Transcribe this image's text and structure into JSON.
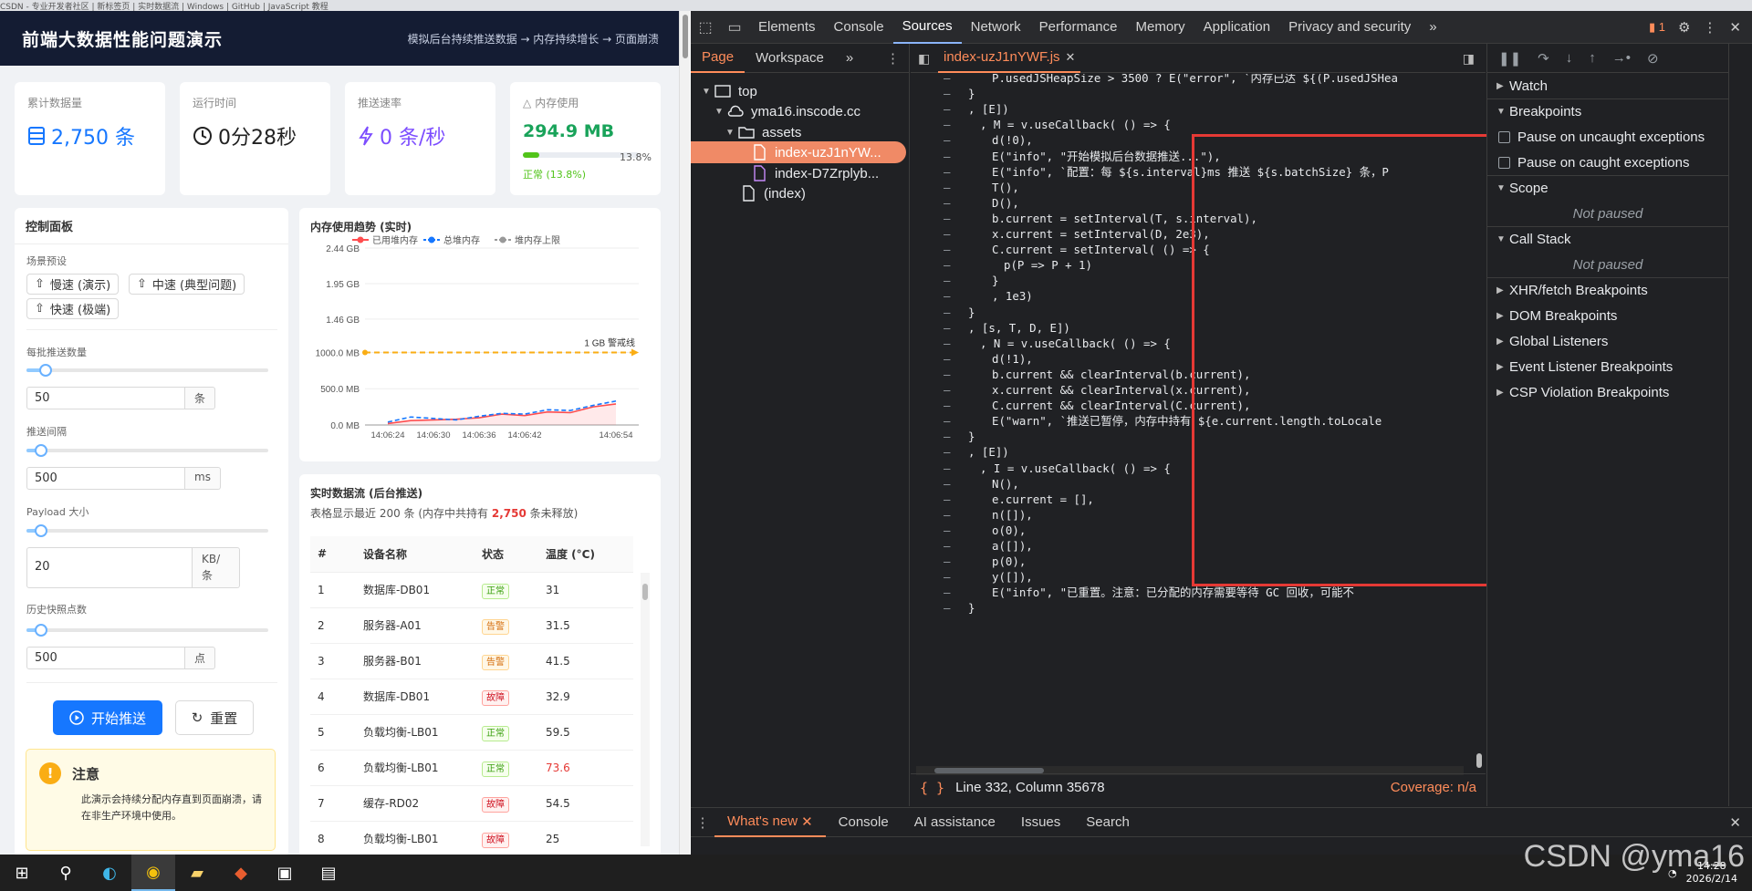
{
  "app": {
    "title": "前端大数据性能问题演示",
    "subtitle": "模拟后台持续推送数据 → 内存持续增长 → 页面崩溃",
    "stats": {
      "total_label": "累计数据量",
      "total_value": "2,750 条",
      "runtime_label": "运行时间",
      "runtime_value": "0分28秒",
      "rate_label": "推送速率",
      "rate_value": "0 条/秒",
      "memory_label": "内存使用",
      "memory_value": "294.9 MB",
      "memory_pct": "13.8%",
      "memory_fraction": 0.138,
      "memory_status": "正常 (13.8%)"
    },
    "control": {
      "title": "控制面板",
      "preset_label": "场景预设",
      "presets": [
        "慢速 (演示)",
        "中速 (典型问题)",
        "快速 (极端)"
      ],
      "batch_label": "每批推送数量",
      "batch_value": "50",
      "batch_unit": "条",
      "batch_fraction": 0.08,
      "interval_label": "推送间隔",
      "interval_value": "500",
      "interval_unit": "ms",
      "interval_fraction": 0.06,
      "payload_label": "Payload 大小",
      "payload_value": "20",
      "payload_unit": "KB/条",
      "payload_fraction": 0.06,
      "snapshot_label": "历史快照点数",
      "snapshot_value": "500",
      "snapshot_unit": "点",
      "snapshot_fraction": 0.06,
      "start_label": "开始推送",
      "reset_label": "重置",
      "notice_title": "注意",
      "notice_text": "此演示会持续分配内存直到页面崩溃，请在非生产环境中使用。"
    },
    "chart_title": "内存使用趋势 (实时)",
    "table": {
      "title": "实时数据流 (后台推送)",
      "sub_prefix": "表格显示最近 200 条 (内存中共持有",
      "sub_count": "2,750",
      "sub_suffix": "条未释放)",
      "headers": [
        "#",
        "设备名称",
        "状态",
        "温度 (°C)"
      ],
      "rows": [
        {
          "n": "1",
          "name": "数据库-DB01",
          "status": "正常",
          "level": "ok",
          "temp": "31"
        },
        {
          "n": "2",
          "name": "服务器-A01",
          "status": "告警",
          "level": "warn",
          "temp": "31.5"
        },
        {
          "n": "3",
          "name": "服务器-B01",
          "status": "告警",
          "level": "warn",
          "temp": "41.5"
        },
        {
          "n": "4",
          "name": "数据库-DB01",
          "status": "故障",
          "level": "err",
          "temp": "32.9"
        },
        {
          "n": "5",
          "name": "负载均衡-LB01",
          "status": "正常",
          "level": "ok",
          "temp": "59.5"
        },
        {
          "n": "6",
          "name": "负载均衡-LB01",
          "status": "正常",
          "level": "ok",
          "temp": "73.6",
          "hot": true
        },
        {
          "n": "7",
          "name": "缓存-RD02",
          "status": "故障",
          "level": "err",
          "temp": "54.5"
        },
        {
          "n": "8",
          "name": "负载均衡-LB01",
          "status": "故障",
          "level": "err",
          "temp": "25"
        }
      ]
    }
  },
  "chart_data": {
    "type": "line",
    "title": "内存使用趋势 (实时)",
    "legend": [
      "已用堆内存",
      "总堆内存",
      "堆内存上限"
    ],
    "legend_position": "top",
    "y_ticks": [
      "2.44 GB",
      "1.95 GB",
      "1.46 GB",
      "1000.0 MB",
      "500.0 MB",
      "0.0 MB"
    ],
    "y_tick_values": [
      2440,
      1950,
      1460,
      1000,
      500,
      0
    ],
    "ylim": [
      0,
      2440
    ],
    "x_ticks": [
      "14:06:24",
      "14:06:30",
      "14:06:36",
      "14:06:42",
      "14:06:54"
    ],
    "x_tick_values": [
      0,
      6,
      12,
      18,
      30
    ],
    "xlim": [
      -3,
      33
    ],
    "threshold": {
      "label": "1 GB 警戒线",
      "value": 1000
    },
    "series": [
      {
        "name": "已用堆内存",
        "color": "#ff4d4f",
        "x": [
          0,
          3,
          6,
          9,
          12,
          15,
          18,
          21,
          24,
          27,
          30
        ],
        "values": [
          20,
          60,
          70,
          80,
          100,
          150,
          130,
          180,
          170,
          250,
          290
        ]
      },
      {
        "name": "总堆内存",
        "color": "#1677ff",
        "x": [
          0,
          3,
          6,
          9,
          12,
          15,
          18,
          21,
          24,
          27,
          30
        ],
        "values": [
          40,
          110,
          90,
          70,
          120,
          160,
          150,
          210,
          200,
          270,
          330
        ]
      }
    ],
    "grid": true
  },
  "browser_tabs": "CSDN - 专业开发者社区 | 新标签页 | 实时数据流 | Windows | GitHub | JavaScript 教程",
  "devtools": {
    "tabs": [
      "Elements",
      "Console",
      "Sources",
      "Network",
      "Performance",
      "Memory",
      "Application",
      "Privacy and security"
    ],
    "active_tab": "Sources",
    "issues_count": "1",
    "nav_tabs": [
      "Page",
      "Workspace"
    ],
    "tree": [
      "top",
      "yma16.inscode.cc",
      "assets",
      "index-uzJ1nYW...",
      "index-D7Zrplyb...",
      "(index)"
    ],
    "file_tab": "index-uzJ1nYWF.js",
    "code_lines": [
      "P.usedJSHeapSize > 3500 ? E(\"error\", `内存已达 ${(P.usedJSHea",
      "}",
      ", [E])",
      ", M = v.useCallback( () => {",
      "d(!0),",
      "E(\"info\", \"开始模拟后台数据推送...\"),",
      "E(\"info\", `配置：每 ${s.interval}ms 推送 ${s.batchSize} 条，P",
      "T(),",
      "D(),",
      "b.current = setInterval(T, s.interval),",
      "x.current = setInterval(D, 2e3),",
      "C.current = setInterval( () => {",
      "p(P => P + 1)",
      "}",
      ", 1e3)",
      "}",
      ", [s, T, D, E])",
      ", N = v.useCallback( () => {",
      "d(!1),",
      "b.current && clearInterval(b.current),",
      "x.current && clearInterval(x.current),",
      "C.current && clearInterval(C.current),",
      "E(\"warn\", `推送已暂停，内存中持有 ${e.current.length.toLocale",
      "}",
      ", [E])",
      ", I = v.useCallback( () => {",
      "N(),",
      "e.current = [],",
      "n([]),",
      "o(0),",
      "a([]),",
      "p(0),",
      "y([]),",
      "E(\"info\", \"已重置。注意：已分配的内存需要等待 GC 回收，可能不",
      "}"
    ],
    "status_line": "Line 332, Column 35678",
    "coverage": "Coverage: n/a",
    "side": {
      "watch": "Watch",
      "breakpoints": "Breakpoints",
      "uncaught": "Pause on uncaught exceptions",
      "caught": "Pause on caught exceptions",
      "scope": "Scope",
      "not_paused": "Not paused",
      "callstack": "Call Stack",
      "not_paused2": "Not paused",
      "xhr": "XHR/fetch Breakpoints",
      "dom": "DOM Breakpoints",
      "global": "Global Listeners",
      "event": "Event Listener Breakpoints",
      "csp": "CSP Violation Breakpoints"
    },
    "drawer_tabs": [
      "What's new",
      "Console",
      "AI assistance",
      "Issues",
      "Search"
    ]
  },
  "taskbar": {
    "time": "14:28",
    "date": "2026/2/14"
  },
  "watermark": "CSDN @yma16"
}
